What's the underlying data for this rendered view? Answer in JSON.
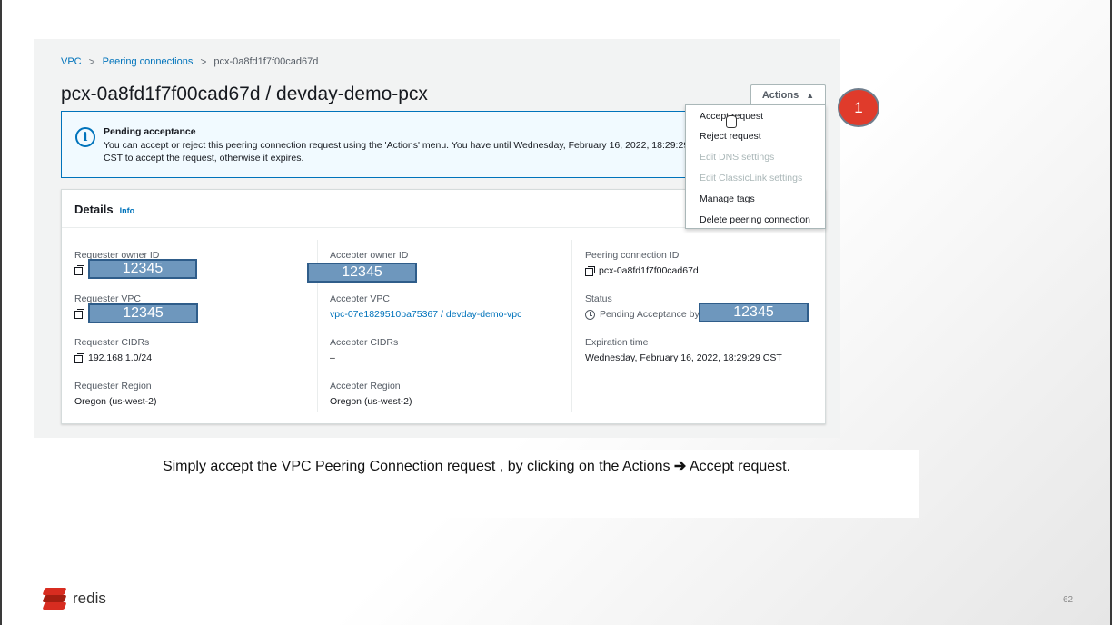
{
  "breadcrumb": {
    "items": [
      "VPC",
      "Peering connections",
      "pcx-0a8fd1f7f00cad67d"
    ],
    "separator": ">"
  },
  "page_title": "pcx-0a8fd1f7f00cad67d / devday-demo-pcx",
  "actions_button": {
    "label": "Actions",
    "caret": "▲"
  },
  "alert": {
    "icon": "info-icon",
    "title": "Pending acceptance",
    "text": "You can accept or reject this peering connection request using the 'Actions' menu. You have until Wednesday, February 16, 2022, 18:29:29 CST to accept the request, otherwise it expires."
  },
  "actions_menu": {
    "items": [
      {
        "label": "Accept request",
        "disabled": false
      },
      {
        "label": "Reject request",
        "disabled": false
      },
      {
        "label": "Edit DNS settings",
        "disabled": true
      },
      {
        "label": "Edit ClassicLink settings",
        "disabled": true
      },
      {
        "label": "Manage tags",
        "disabled": false
      },
      {
        "label": "Delete peering connection",
        "disabled": false
      }
    ]
  },
  "step_badge": "1",
  "details": {
    "title": "Details",
    "info_link": "Info",
    "requester_owner_id": {
      "label": "Requester owner ID",
      "value": "12345"
    },
    "accepter_owner_id": {
      "label": "Accepter owner ID",
      "value": "12345"
    },
    "peering_connection_id": {
      "label": "Peering connection ID",
      "value": "pcx-0a8fd1f7f00cad67d"
    },
    "requester_vpc": {
      "label": "Requester VPC",
      "value": "12345"
    },
    "accepter_vpc": {
      "label": "Accepter VPC",
      "value": "vpc-07e1829510ba75367 / devday-demo-vpc"
    },
    "status": {
      "label": "Status",
      "value": "Pending Acceptance by",
      "redacted_value": "12345"
    },
    "requester_cidrs": {
      "label": "Requester CIDRs",
      "value": "192.168.1.0/24"
    },
    "accepter_cidrs": {
      "label": "Accepter CIDRs",
      "value": "–"
    },
    "expiration_time": {
      "label": "Expiration time",
      "value": "Wednesday, February 16, 2022, 18:29:29 CST"
    },
    "requester_region": {
      "label": "Requester Region",
      "value": "Oregon (us-west-2)"
    },
    "accepter_region": {
      "label": "Accepter Region",
      "value": "Oregon (us-west-2)"
    }
  },
  "caption": {
    "before": "Simply accept the VPC Peering Connection request , by clicking on the Actions",
    "arrow": "➔",
    "after": "Accept request."
  },
  "footer": {
    "brand": "redis",
    "page_number": "62"
  },
  "colors": {
    "link": "#0073bb",
    "badge": "#e03b2b",
    "redaction": "#6e97bd",
    "brand_red": "#d82c20"
  }
}
